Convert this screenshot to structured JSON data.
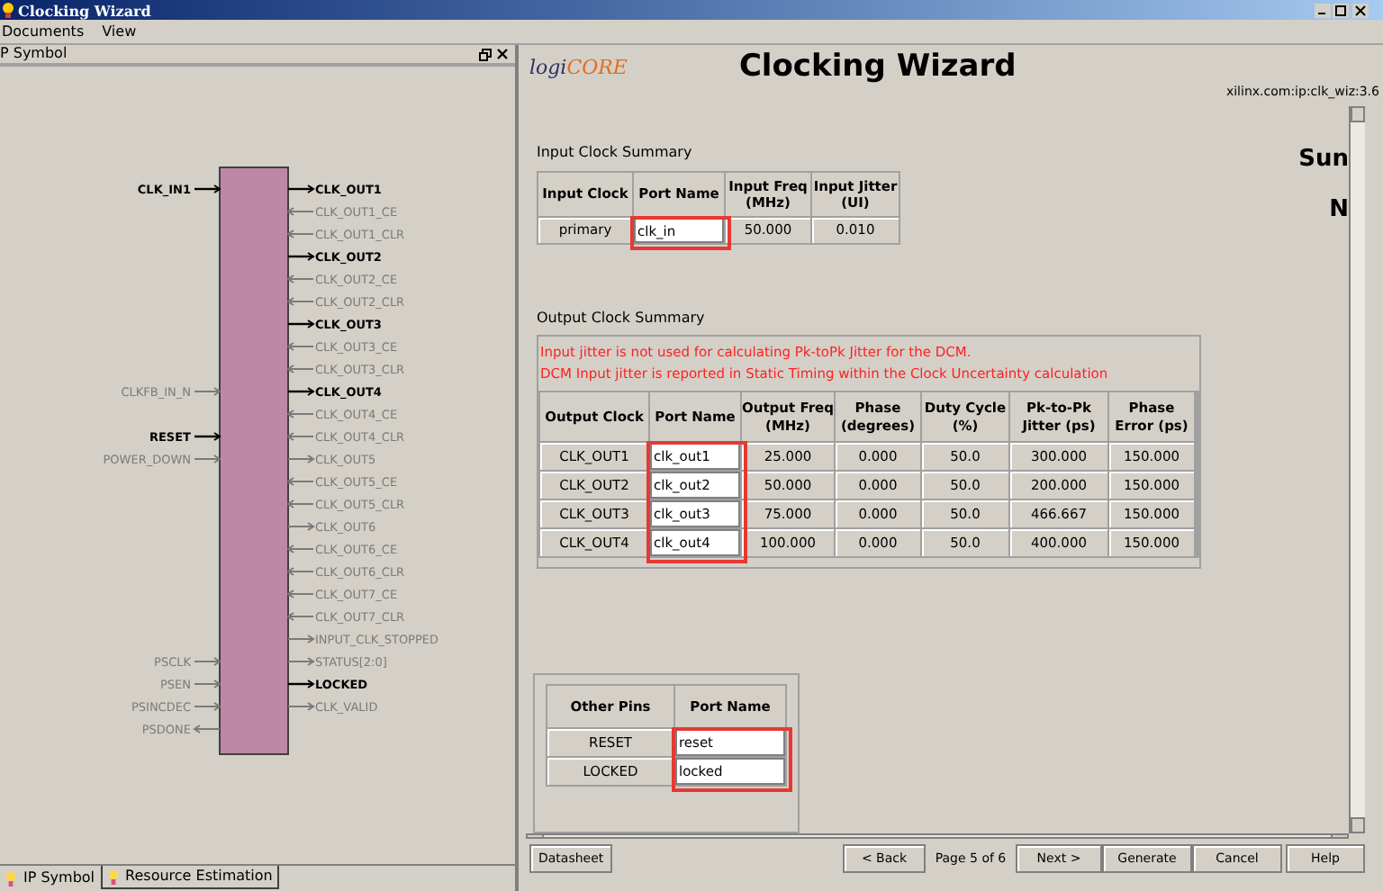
{
  "window": {
    "title": "Clocking Wizard"
  },
  "menu": [
    "Documents",
    "View"
  ],
  "symbol_panel": {
    "title": "P Symbol",
    "rows": [
      {
        "left": {
          "name": "CLK_IN1",
          "active": true,
          "kind": "input"
        },
        "right": {
          "name": "CLK_OUT1",
          "active": true,
          "kind": "output"
        }
      },
      {
        "right": {
          "name": "CLK_OUT1_CE",
          "active": false,
          "kind": "input"
        }
      },
      {
        "right": {
          "name": "CLK_OUT1_CLR",
          "active": false,
          "kind": "input"
        }
      },
      {
        "right": {
          "name": "CLK_OUT2",
          "active": true,
          "kind": "output"
        }
      },
      {
        "right": {
          "name": "CLK_OUT2_CE",
          "active": false,
          "kind": "input"
        }
      },
      {
        "right": {
          "name": "CLK_OUT2_CLR",
          "active": false,
          "kind": "input"
        }
      },
      {
        "right": {
          "name": "CLK_OUT3",
          "active": true,
          "kind": "output"
        }
      },
      {
        "right": {
          "name": "CLK_OUT3_CE",
          "active": false,
          "kind": "input"
        }
      },
      {
        "right": {
          "name": "CLK_OUT3_CLR",
          "active": false,
          "kind": "input"
        }
      },
      {
        "left": {
          "name": "CLKFB_IN_N",
          "active": false,
          "kind": "input"
        },
        "right": {
          "name": "CLK_OUT4",
          "active": true,
          "kind": "output"
        }
      },
      {
        "right": {
          "name": "CLK_OUT4_CE",
          "active": false,
          "kind": "input"
        }
      },
      {
        "left": {
          "name": "RESET",
          "active": true,
          "kind": "input"
        },
        "right": {
          "name": "CLK_OUT4_CLR",
          "active": false,
          "kind": "input"
        }
      },
      {
        "left": {
          "name": "POWER_DOWN",
          "active": false,
          "kind": "input"
        },
        "right": {
          "name": "CLK_OUT5",
          "active": false,
          "kind": "output"
        }
      },
      {
        "right": {
          "name": "CLK_OUT5_CE",
          "active": false,
          "kind": "input"
        }
      },
      {
        "right": {
          "name": "CLK_OUT5_CLR",
          "active": false,
          "kind": "input"
        }
      },
      {
        "right": {
          "name": "CLK_OUT6",
          "active": false,
          "kind": "output"
        }
      },
      {
        "right": {
          "name": "CLK_OUT6_CE",
          "active": false,
          "kind": "input"
        }
      },
      {
        "right": {
          "name": "CLK_OUT6_CLR",
          "active": false,
          "kind": "input"
        }
      },
      {
        "right": {
          "name": "CLK_OUT7_CE",
          "active": false,
          "kind": "input"
        }
      },
      {
        "right": {
          "name": "CLK_OUT7_CLR",
          "active": false,
          "kind": "input"
        }
      },
      {
        "right": {
          "name": "INPUT_CLK_STOPPED",
          "active": false,
          "kind": "output"
        }
      },
      {
        "left": {
          "name": "PSCLK",
          "active": false,
          "kind": "input"
        },
        "right": {
          "name": "STATUS[2:0]",
          "active": false,
          "kind": "output"
        }
      },
      {
        "left": {
          "name": "PSEN",
          "active": false,
          "kind": "input"
        },
        "right": {
          "name": "LOCKED",
          "active": true,
          "kind": "output"
        }
      },
      {
        "left": {
          "name": "PSINCDEC",
          "active": false,
          "kind": "input"
        },
        "right": {
          "name": "CLK_VALID",
          "active": false,
          "kind": "output"
        }
      },
      {
        "left": {
          "name": "PSDONE",
          "active": false,
          "kind": "output"
        }
      }
    ]
  },
  "bottom_tabs": [
    {
      "label": "IP Symbol",
      "selected": true
    },
    {
      "label": "Resource Estimation",
      "selected": false
    }
  ],
  "header": {
    "logo": [
      "logi",
      "CORE"
    ],
    "title": "Clocking Wizard",
    "ip_id": "xilinx.com:ip:clk_wiz:3.6"
  },
  "input_clock_summary": {
    "title": "Input Clock Summary",
    "columns": [
      "Input Clock",
      "Port Name",
      "Input Freq (MHz)",
      "Input Jitter (UI)"
    ],
    "rows": [
      [
        "primary",
        "clk_in",
        "50.000",
        "0.010"
      ]
    ]
  },
  "output_clock_summary": {
    "title": "Output Clock Summary",
    "notes": [
      "Input jitter is not used for calculating Pk-toPk Jitter for the DCM.",
      "DCM Input jitter is reported in Static Timing within the Clock Uncertainty calculation"
    ],
    "columns": [
      "Output Clock",
      "Port Name",
      "Output Freq (MHz)",
      "Phase (degrees)",
      "Duty Cycle (%)",
      "Pk-to-Pk Jitter (ps)",
      "Phase Error (ps)"
    ],
    "rows": [
      [
        "CLK_OUT1",
        "clk_out1",
        "25.000",
        "0.000",
        "50.0",
        "300.000",
        "150.000"
      ],
      [
        "CLK_OUT2",
        "clk_out2",
        "50.000",
        "0.000",
        "50.0",
        "200.000",
        "150.000"
      ],
      [
        "CLK_OUT3",
        "clk_out3",
        "75.000",
        "0.000",
        "50.0",
        "466.667",
        "150.000"
      ],
      [
        "CLK_OUT4",
        "clk_out4",
        "100.000",
        "0.000",
        "50.0",
        "400.000",
        "150.000"
      ]
    ]
  },
  "other_pins": {
    "columns": [
      "Other Pins",
      "Port Name"
    ],
    "rows": [
      [
        "RESET",
        "reset"
      ],
      [
        "LOCKED",
        "locked"
      ]
    ]
  },
  "side_text": [
    "Sun",
    "N"
  ],
  "buttons": {
    "datasheet": "Datasheet",
    "back": "< Back",
    "page": "Page 5 of 6",
    "next": "Next >",
    "generate": "Generate",
    "cancel": "Cancel",
    "help": "Help"
  }
}
